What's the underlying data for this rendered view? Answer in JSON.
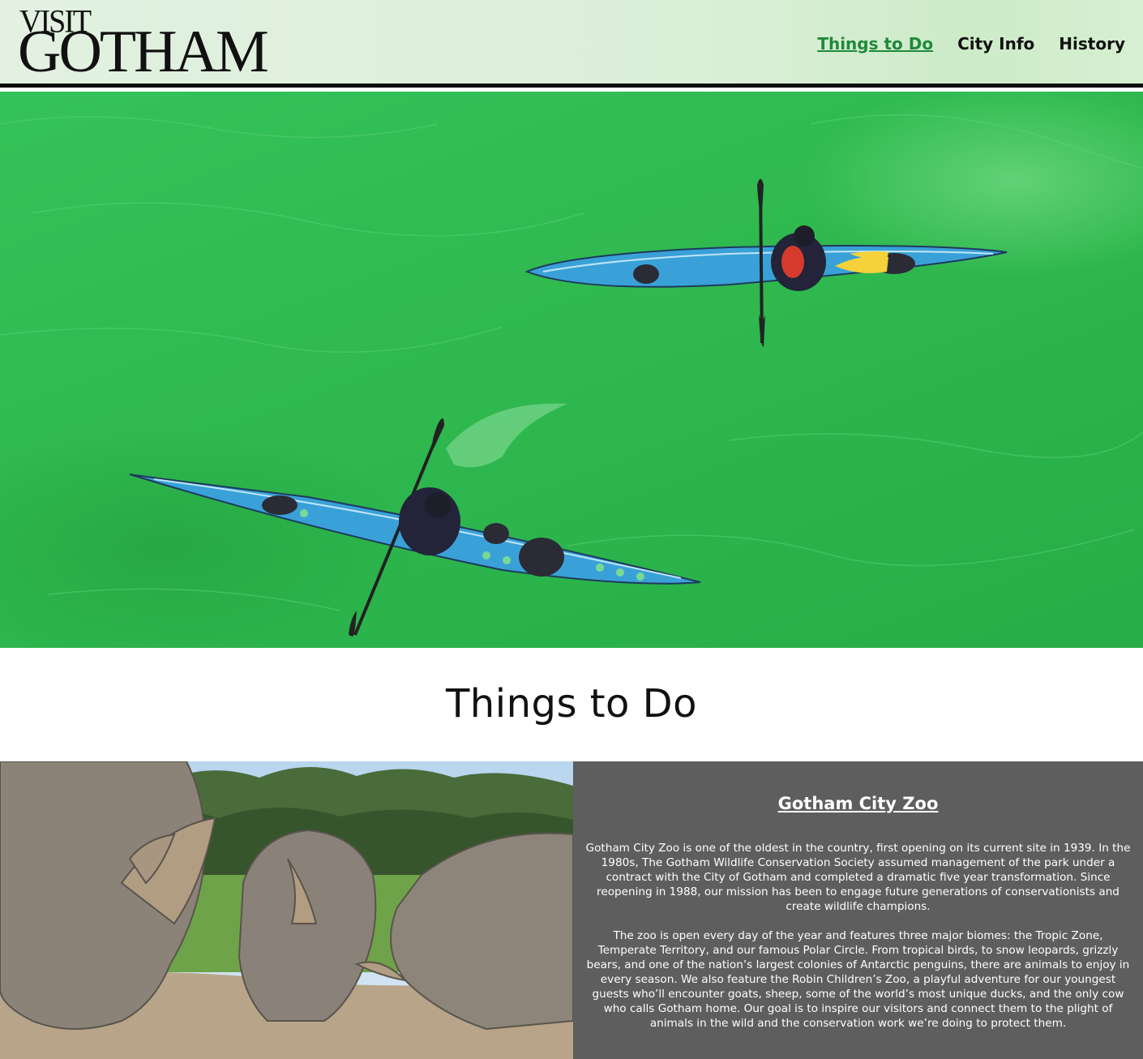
{
  "header": {
    "logo_top": "VISIT",
    "logo_bottom": "GOTHAM",
    "nav": [
      {
        "label": "Things to Do",
        "active": true
      },
      {
        "label": "City Info",
        "active": false
      },
      {
        "label": "History",
        "active": false
      }
    ]
  },
  "main": {
    "section_title": "Things to Do"
  },
  "zoo": {
    "heading": "Gotham City Zoo",
    "paragraph_1": "Gotham City Zoo is one of the oldest in the country, first opening on its current site in 1939. In the 1980s, The Gotham Wildlife Conservation Society assumed management of the park under a contract with the City of Gotham and completed a dramatic five year transformation. Since reopening in 1988, our mission has been to engage future generations of conservationists and create wildlife champions.",
    "paragraph_2": "The zoo is open every day of the year and features three major biomes: the Tropic Zone, Temperate Territory, and our famous Polar Circle. From tropical birds, to snow leopards, grizzly bears, and one of the nation’s largest colonies of Antarctic penguins, there are animals to enjoy in every season. We also feature the Robin Children’s Zoo, a playful adventure for our youngest guests who’ll encounter goats, sheep, some of the world’s most unique ducks, and the only cow who calls Gotham home. Our goal is to inspire our visitors and connect them to the plight of animals in the wild and the conservation work we’re doing to protect them."
  },
  "colors": {
    "nav_active": "#1e8a3a",
    "header_bg": "#dcefd9",
    "water": "#2fb94f",
    "zoo_panel_bg": "#5e5e5e"
  }
}
